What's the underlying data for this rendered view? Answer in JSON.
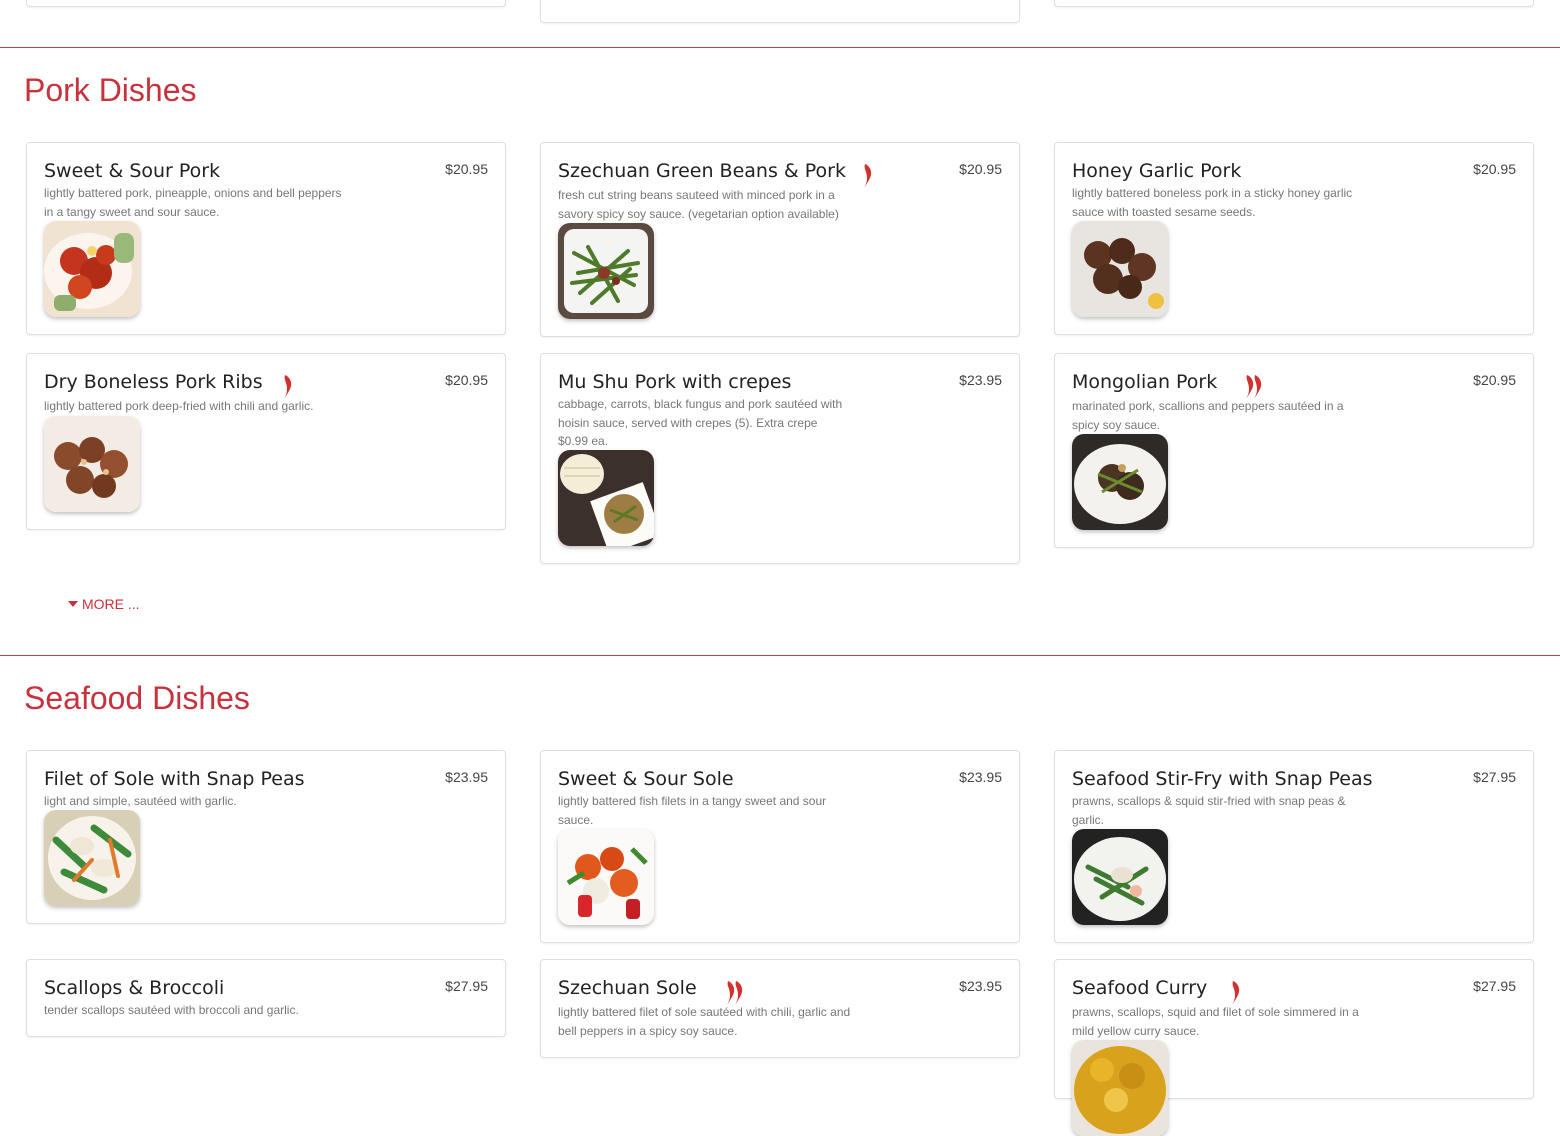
{
  "pork": {
    "title": "Pork Dishes",
    "more_label": "MORE ...",
    "items": [
      {
        "name": "Sweet & Sour Pork",
        "price": "$20.95",
        "desc": "lightly battered pork, pineapple, onions and bell peppers in a tangy sweet and sour sauce."
      },
      {
        "name": "Szechuan Green Beans & Pork",
        "price": "$20.95",
        "desc": "fresh cut string beans sauteed with minced pork in a savory spicy soy sauce. (vegetarian option available)"
      },
      {
        "name": "Honey Garlic Pork",
        "price": "$20.95",
        "desc": "lightly battered boneless pork in a sticky honey garlic sauce with toasted sesame seeds."
      },
      {
        "name": "Dry Boneless Pork Ribs",
        "price": "$20.95",
        "desc": "lightly battered pork deep-fried with chili and garlic."
      },
      {
        "name": "Mu Shu Pork with crepes",
        "price": "$23.95",
        "desc": "cabbage, carrots, black fungus and pork sautéed with hoisin sauce, served with crepes (5). Extra crepe $0.99 ea."
      },
      {
        "name": "Mongolian Pork",
        "price": "$20.95",
        "desc": "marinated pork, scallions and peppers sautéed in a spicy soy sauce."
      }
    ]
  },
  "seafood": {
    "title": "Seafood Dishes",
    "items": [
      {
        "name": "Filet of Sole with Snap Peas",
        "price": "$23.95",
        "desc": "light and simple, sautéed with garlic."
      },
      {
        "name": "Sweet & Sour Sole",
        "price": "$23.95",
        "desc": "lightly battered fish filets in a tangy sweet and sour sauce."
      },
      {
        "name": "Seafood Stir-Fry with Snap Peas",
        "price": "$27.95",
        "desc": "prawns, scallops & squid stir-fried with snap peas & garlic."
      },
      {
        "name": "Scallops & Broccoli",
        "price": "$27.95",
        "desc": "tender scallops sautéed with broccoli and garlic."
      },
      {
        "name": "Szechuan Sole",
        "price": "$23.95",
        "desc": "lightly battered filet of sole sautéed with chili, garlic and bell peppers in a spicy soy sauce."
      },
      {
        "name": "Seafood Curry",
        "price": "$27.95",
        "desc": "prawns, scallops, squid and filet of sole simmered in a mild yellow curry sauce."
      }
    ]
  },
  "colors": {
    "accent": "#c8323c",
    "chili": "#d2322d"
  },
  "icons": {
    "spicy": "chili-pepper-icon",
    "more": "caret-down-icon"
  }
}
